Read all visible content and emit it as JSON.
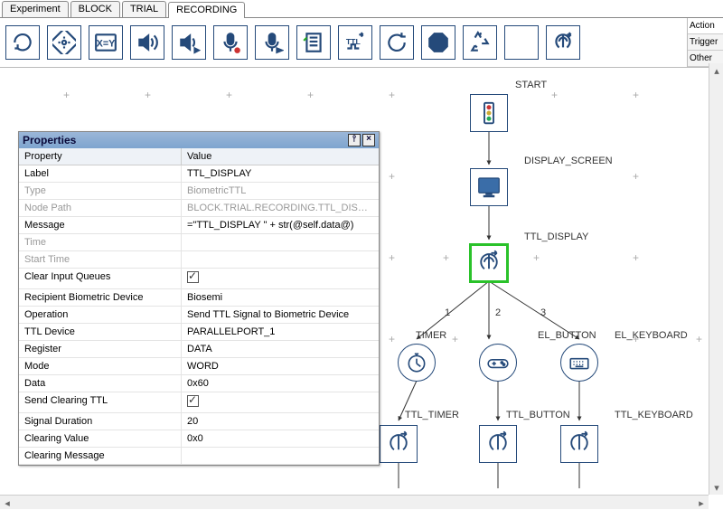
{
  "tabs": [
    "Experiment",
    "BLOCK",
    "TRIAL",
    "RECORDING"
  ],
  "active_tab": 3,
  "side_tabs": [
    "Action",
    "Trigger",
    "Other"
  ],
  "active_side_tab": 0,
  "toolbar_icons": [
    "loop-icon",
    "anchor-icon",
    "assign-icon",
    "play-sound-icon",
    "control-sound-icon",
    "record-sound-icon",
    "stop-record-icon",
    "log-icon",
    "ttl-icon",
    "reset-icon",
    "stop-icon",
    "recycle-icon",
    "blank-icon",
    "biometric-icon"
  ],
  "properties": {
    "title": "Properties",
    "header_property": "Property",
    "header_value": "Value",
    "rows": [
      {
        "label": "Label",
        "value": "TTL_DISPLAY",
        "editable": true
      },
      {
        "label": "Type",
        "value": "BiometricTTL",
        "dim": true
      },
      {
        "label": "Node Path",
        "value": "BLOCK.TRIAL.RECORDING.TTL_DISPLAY",
        "dim": true
      },
      {
        "label": "Message",
        "value": "=\"TTL_DISPLAY \" + str(@self.data@)",
        "editable": true
      },
      {
        "label": "Time",
        "value": "",
        "dim": true
      },
      {
        "label": "Start Time",
        "value": "",
        "dim": true
      },
      {
        "label": "Clear Input Queues",
        "value": "check:true",
        "editable": true
      },
      {
        "label": "Recipient Biometric Device",
        "value": "Biosemi",
        "editable": true
      },
      {
        "label": "Operation",
        "value": "Send TTL Signal to Biometric Device",
        "editable": true
      },
      {
        "label": "TTL Device",
        "value": "PARALLELPORT_1",
        "editable": true
      },
      {
        "label": "Register",
        "value": "DATA",
        "editable": true
      },
      {
        "label": "Mode",
        "value": "WORD",
        "editable": true
      },
      {
        "label": "Data",
        "value": "0x60",
        "editable": true
      },
      {
        "label": "Send Clearing TTL",
        "value": "check:true",
        "editable": true
      },
      {
        "label": "Signal Duration",
        "value": "20",
        "editable": true
      },
      {
        "label": "Clearing Value",
        "value": "0x0",
        "editable": true
      },
      {
        "label": "Clearing Message",
        "value": "",
        "editable": true
      }
    ]
  },
  "nodes": {
    "start": "START",
    "display": "DISPLAY_SCREEN",
    "ttl_display": "TTL_DISPLAY",
    "timer": "TIMER",
    "el_button": "EL_BUTTON",
    "el_keyboard": "EL_KEYBOARD",
    "ttl_timer": "TTL_TIMER",
    "ttl_button": "TTL_BUTTON",
    "ttl_keyboard": "TTL_KEYBOARD"
  },
  "edge_labels": [
    "1",
    "2",
    "3"
  ]
}
